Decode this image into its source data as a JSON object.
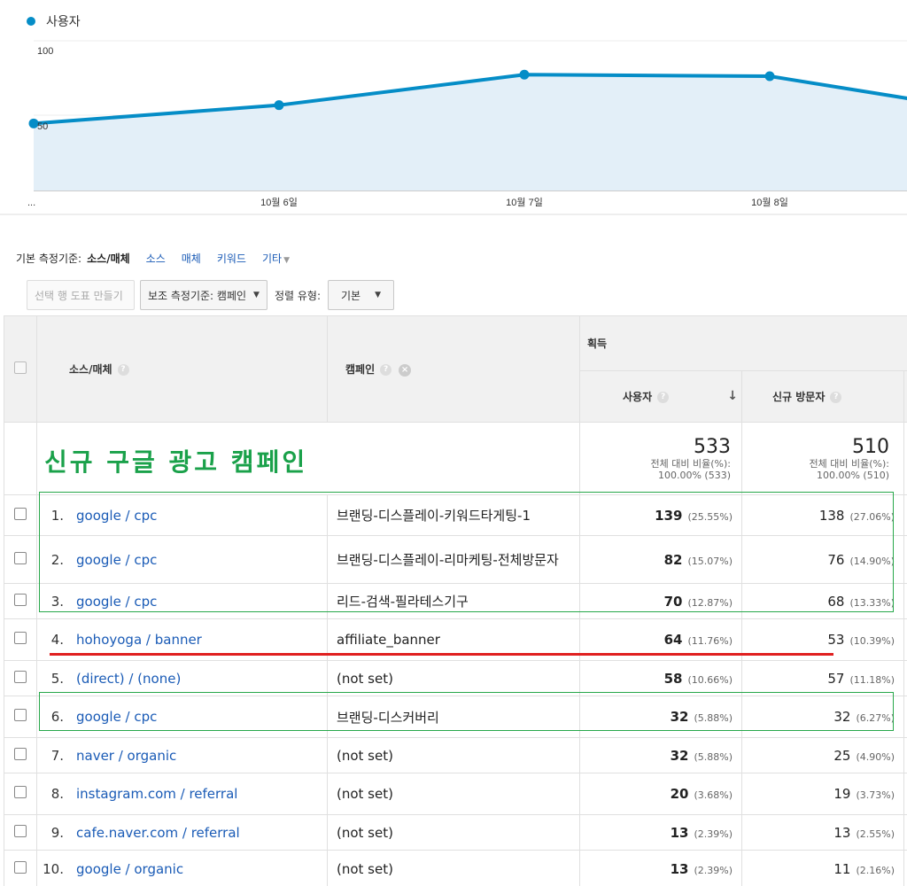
{
  "chart": {
    "legend": "사용자",
    "y_ticks": [
      "100",
      "50"
    ],
    "x_ticks": [
      "...",
      "10월 6일",
      "10월 7일",
      "10월 8일"
    ]
  },
  "chart_data": {
    "type": "area",
    "series": [
      {
        "name": "사용자",
        "values": [
          44,
          56,
          76,
          75,
          59
        ]
      }
    ],
    "categories": [
      "",
      "10월 6일",
      "10월 7일",
      "10월 8일",
      ""
    ],
    "ylim": [
      0,
      125
    ],
    "color": "#058dc7",
    "fill": "#e3eff8"
  },
  "dimension_bar": {
    "label": "기본 측정기준:",
    "current": "소스/매체",
    "links": [
      "소스",
      "매체",
      "키워드",
      "기타"
    ]
  },
  "toolbar": {
    "plot_rows": "선택 행 도표 만들기",
    "secondary_dim": "보조 측정기준: 캠페인",
    "sort_label": "정렬 유형:",
    "sort_value": "기본"
  },
  "table": {
    "headers": {
      "source_medium": "소스/매체",
      "campaign": "캠페인",
      "group": "획득",
      "users": "사용자",
      "new_users": "신규 방문자"
    },
    "totals": {
      "users": "533",
      "users_sub1": "전체 대비 비율(%):",
      "users_sub2": "100.00% (533)",
      "new_users": "510",
      "new_sub1": "전체 대비 비율(%):",
      "new_sub2": "100.00% (510)"
    },
    "annotation": "신규 구글 광고 캠페인",
    "rows": [
      {
        "num": "1.",
        "source": "google / cpc",
        "campaign": "브랜딩-디스플레이-키워드타게팅-1",
        "users": "139",
        "users_pct": "(25.55%)",
        "new_users": "138",
        "new_pct": "(27.06%)"
      },
      {
        "num": "2.",
        "source": "google / cpc",
        "campaign": "브랜딩-디스플레이-리마케팅-전체방문자",
        "users": "82",
        "users_pct": "(15.07%)",
        "new_users": "76",
        "new_pct": "(14.90%)"
      },
      {
        "num": "3.",
        "source": "google / cpc",
        "campaign": "리드-검색-필라테스기구",
        "users": "70",
        "users_pct": "(12.87%)",
        "new_users": "68",
        "new_pct": "(13.33%)"
      },
      {
        "num": "4.",
        "source": "hohoyoga / banner",
        "campaign": "affiliate_banner",
        "users": "64",
        "users_pct": "(11.76%)",
        "new_users": "53",
        "new_pct": "(10.39%)"
      },
      {
        "num": "5.",
        "source": "(direct) / (none)",
        "campaign": "(not set)",
        "users": "58",
        "users_pct": "(10.66%)",
        "new_users": "57",
        "new_pct": "(11.18%)"
      },
      {
        "num": "6.",
        "source": "google / cpc",
        "campaign": "브랜딩-디스커버리",
        "users": "32",
        "users_pct": "(5.88%)",
        "new_users": "32",
        "new_pct": "(6.27%)"
      },
      {
        "num": "7.",
        "source": "naver / organic",
        "campaign": "(not set)",
        "users": "32",
        "users_pct": "(5.88%)",
        "new_users": "25",
        "new_pct": "(4.90%)"
      },
      {
        "num": "8.",
        "source": "instagram.com / referral",
        "campaign": "(not set)",
        "users": "20",
        "users_pct": "(3.68%)",
        "new_users": "19",
        "new_pct": "(3.73%)"
      },
      {
        "num": "9.",
        "source": "cafe.naver.com / referral",
        "campaign": "(not set)",
        "users": "13",
        "users_pct": "(2.39%)",
        "new_users": "13",
        "new_pct": "(2.55%)"
      },
      {
        "num": "10.",
        "source": "google / organic",
        "campaign": "(not set)",
        "users": "13",
        "users_pct": "(2.39%)",
        "new_users": "11",
        "new_pct": "(2.16%)"
      }
    ]
  }
}
